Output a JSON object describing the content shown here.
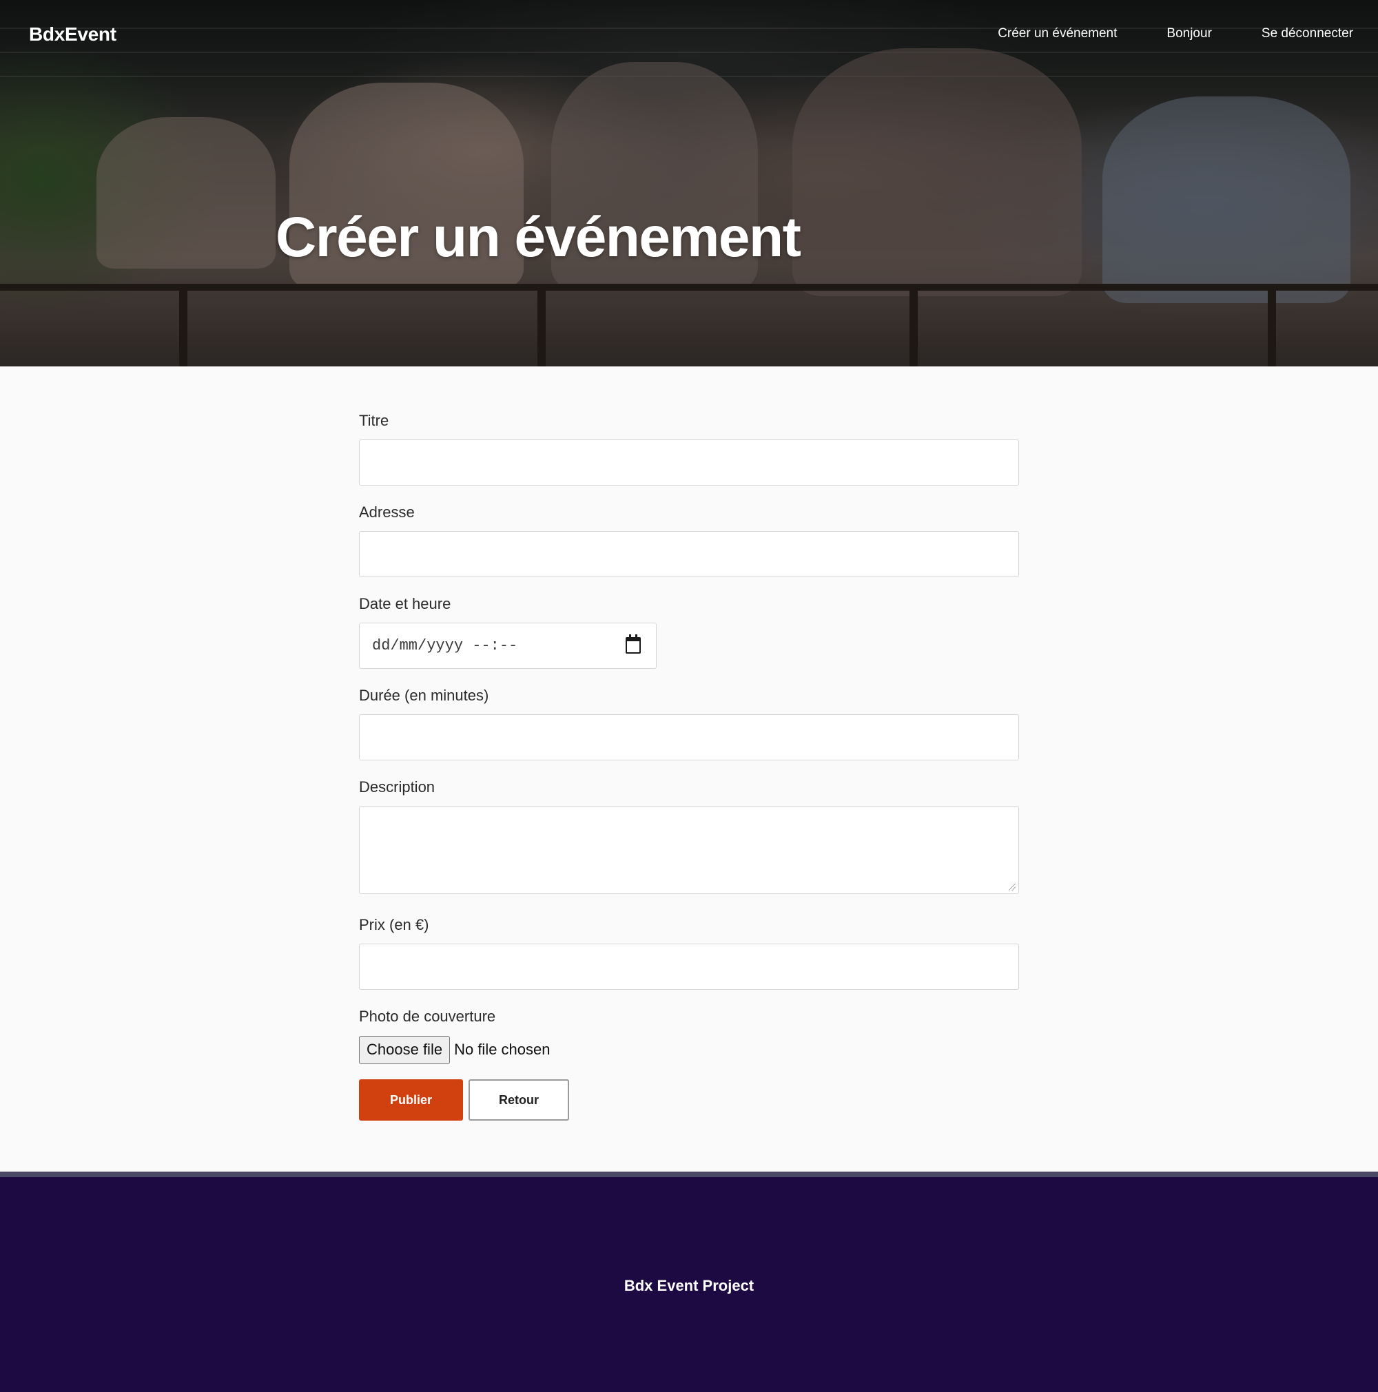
{
  "header": {
    "brand": "BdxEvent",
    "nav": {
      "create_event": "Créer un événement",
      "greeting": "Bonjour",
      "logout": "Se déconnecter"
    },
    "hero_title": "Créer un événement"
  },
  "form": {
    "title_label": "Titre",
    "title_value": "",
    "address_label": "Adresse",
    "address_value": "",
    "datetime_label": "Date et heure",
    "datetime_placeholder": "dd/mm/yyyy --:--",
    "duration_label": "Durée (en minutes)",
    "duration_value": "",
    "description_label": "Description",
    "description_value": "",
    "price_label": "Prix (en €)",
    "price_value": "",
    "cover_label": "Photo de couverture",
    "file_button": "Choose file",
    "file_status": "No file chosen",
    "submit_label": "Publier",
    "back_label": "Retour"
  },
  "footer": {
    "text": "Bdx Event Project"
  },
  "colors": {
    "primary": "#d1400f",
    "footer_bg": "#1e0a42",
    "footer_strip": "#4c4966",
    "page_bg": "#fafafa"
  },
  "icons": {
    "datetime_picker": "calendar-icon"
  }
}
